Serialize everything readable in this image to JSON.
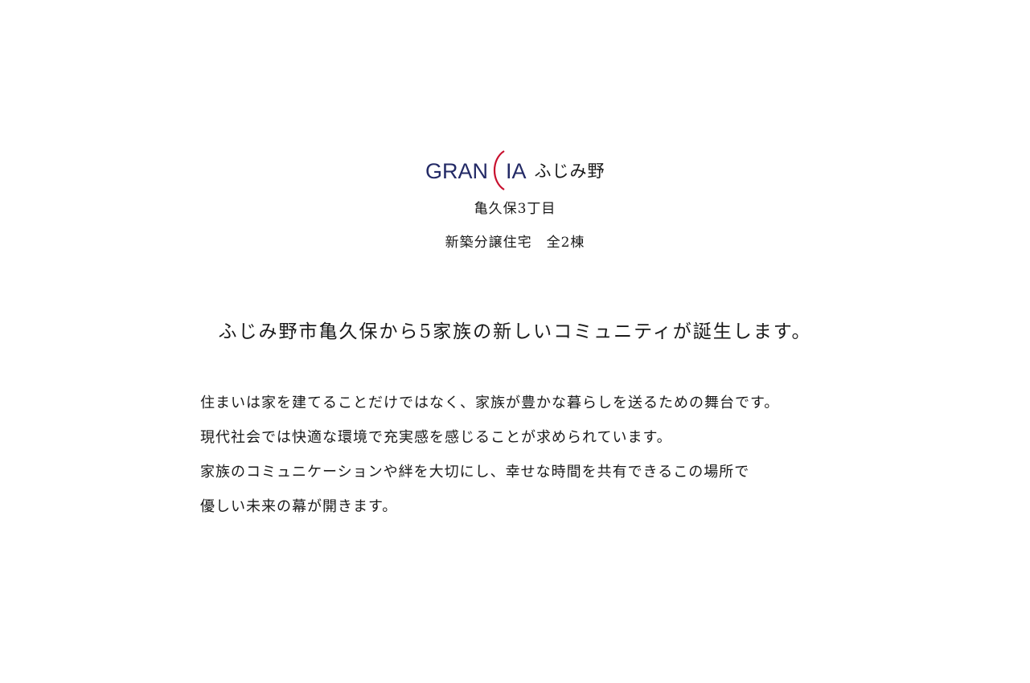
{
  "logo": {
    "brand": "GRANCIA",
    "brand_left": "GRAN",
    "brand_right": "IA",
    "location_name": "ふじみ野",
    "brand_color": "#232a66",
    "accent_color": "#c8102e"
  },
  "address": "亀久保3丁目",
  "subtitle": "新築分譲住宅　全2棟",
  "headline": "ふじみ野市亀久保から5家族の新しいコミュニティが誕生します。",
  "body": {
    "line1": "住まいは家を建てることだけではなく、家族が豊かな暮らしを送るための舞台です。",
    "line2": "現代社会では快適な環境で充実感を感じることが求められています。",
    "line3": "家族のコミュニケーションや絆を大切にし、幸せな時間を共有できるこの場所で",
    "line4": "優しい未来の幕が開きます。"
  }
}
